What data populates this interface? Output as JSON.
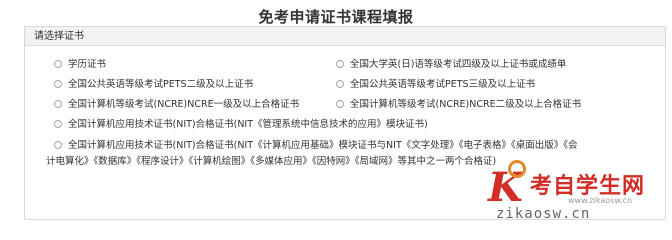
{
  "page": {
    "title": "免考申请证书课程填报"
  },
  "panel": {
    "header": "请选择证书"
  },
  "options": [
    "学历证书",
    "全国大学英(日)语等级考试四级及以上证书或成绩单",
    "全国公共英语等级考试PETS二级及以上证书",
    "全国公共英语等级考试PETS三级及以上证书",
    "全国计算机等级考试(NCRE)NCRE一级及以上合格证书",
    "全国计算机等级考试(NCRE)NCRE二级及以上合格证书",
    "全国计算机应用技术证书(NIT)合格证书(NIT《管理系统中信息技术的应用》模块证书)",
    "全国计算机应用技术证书(NIT)合格证书(NIT《计算机应用基础》模块证书与NIT《文字处理》《电子表格》《桌面出版》《会",
    "计电算化》《数据库》《程序设计》《计算机绘图》《多媒体应用》《因特网》《局域网》等其中之一两个合格证)"
  ],
  "watermark": {
    "letter": "K",
    "name": "考自学生网",
    "url": "zikaosw.cn",
    "url_small": "www.zikaosw.cn"
  },
  "colors": {
    "brand_red": "#d42d27",
    "brand_orange": "#e08a2a"
  }
}
